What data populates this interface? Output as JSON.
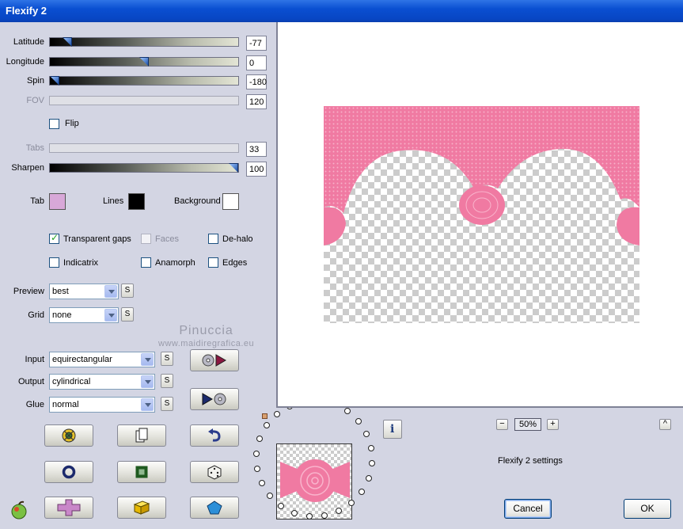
{
  "window": {
    "title": "Flexify 2"
  },
  "sliders": [
    {
      "label": "Latitude",
      "value": "-77",
      "position": 0.09,
      "enabled": true
    },
    {
      "label": "Longitude",
      "value": "0",
      "position": 0.5,
      "enabled": true
    },
    {
      "label": "Spin",
      "value": "-180",
      "position": 0.0,
      "enabled": true
    },
    {
      "label": "FOV",
      "value": "120",
      "enabled": false
    },
    {
      "label": "Tabs",
      "value": "33",
      "enabled": false
    },
    {
      "label": "Sharpen",
      "value": "100",
      "position": 1.0,
      "enabled": true
    }
  ],
  "flip": {
    "label": "Flip",
    "checked": false
  },
  "colors": {
    "tab": {
      "label": "Tab",
      "value": "#d8a8d8"
    },
    "lines": {
      "label": "Lines",
      "value": "#000000"
    },
    "background": {
      "label": "Background",
      "value": "#ffffff"
    },
    "accent_pink": "#f07aa2"
  },
  "options": {
    "transparent_gaps": {
      "label": "Transparent gaps",
      "checked": true
    },
    "faces": {
      "label": "Faces",
      "checked": false,
      "enabled": false
    },
    "de_halo": {
      "label": "De-halo",
      "checked": false
    },
    "indicatrix": {
      "label": "Indicatrix",
      "checked": false
    },
    "anamorph": {
      "label": "Anamorph",
      "checked": false
    },
    "edges": {
      "label": "Edges",
      "checked": false
    }
  },
  "preview_select": {
    "label": "Preview",
    "value": "best"
  },
  "grid_select": {
    "label": "Grid",
    "value": "none"
  },
  "input_select": {
    "label": "Input",
    "value": "equirectangular"
  },
  "output_select": {
    "label": "Output",
    "value": "cylindrical"
  },
  "glue_select": {
    "label": "Glue",
    "value": "normal"
  },
  "small_button_label": "S",
  "watermark": {
    "line1": "Pinuccia",
    "line2": "www.maidiregrafica.eu"
  },
  "zoom": {
    "value": "50%",
    "minus": "−",
    "plus": "+"
  },
  "collapse_label": "^",
  "info_label": "i",
  "settings_name": "Flexify 2 settings",
  "buttons": {
    "cancel": "Cancel",
    "ok": "OK"
  },
  "icons": [
    "load-preset-icon",
    "save-preset-icon",
    "gear-reset-icon",
    "copy-icon",
    "undo-icon",
    "ring-icon",
    "square-icon",
    "dice-icon",
    "plus-shape-icon",
    "cube-icon",
    "pentagon-icon",
    "apple-logo-icon"
  ]
}
